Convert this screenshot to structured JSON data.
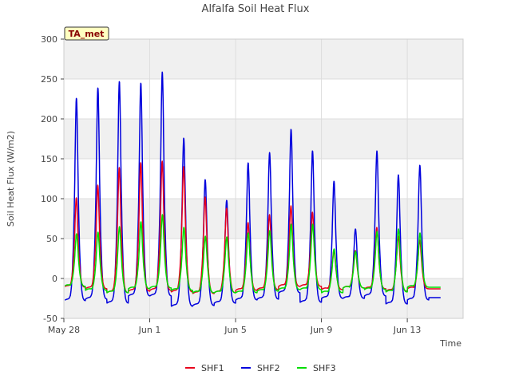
{
  "chart_data": {
    "type": "line",
    "title": "Alfalfa Soil Heat Flux",
    "xlabel": "Time",
    "ylabel": "Soil Heat Flux (W/m2)",
    "badge": "TA_met",
    "ylim": [
      -50,
      300
    ],
    "yticks": [
      -50,
      0,
      50,
      100,
      150,
      200,
      250,
      300
    ],
    "xlim_days": [
      0,
      18.6
    ],
    "xticks": [
      {
        "day": 0,
        "label": "May 28"
      },
      {
        "day": 4,
        "label": "Jun 1"
      },
      {
        "day": 8,
        "label": "Jun 5"
      },
      {
        "day": 12,
        "label": "Jun 9"
      },
      {
        "day": 16,
        "label": "Jun 13"
      }
    ],
    "legend_position": "bottom",
    "grid": true,
    "daily_peaks": {
      "days": [
        0,
        1,
        2,
        3,
        4,
        5,
        6,
        7,
        8,
        9,
        10,
        11,
        12,
        13,
        14,
        15,
        16,
        17
      ],
      "series": [
        {
          "name": "SHF1",
          "color": "#e8001c",
          "peak": [
            101,
            117,
            139,
            145,
            147,
            140,
            102,
            88,
            70,
            80,
            91,
            83,
            35,
            35,
            64,
            53,
            48,
            -1
          ],
          "min": [
            -11,
            -13,
            -18,
            -16,
            -15,
            -17,
            -19,
            -18,
            -15,
            -14,
            -10,
            -10,
            -14,
            -12,
            -13,
            -16,
            -13,
            -13
          ]
        },
        {
          "name": "SHF2",
          "color": "#0000dd",
          "peak": [
            226,
            239,
            247,
            245,
            259,
            176,
            124,
            98,
            145,
            158,
            187,
            160,
            122,
            62,
            160,
            130,
            142,
            -1
          ],
          "min": [
            -28,
            -26,
            -31,
            -22,
            -22,
            -35,
            -34,
            -31,
            -27,
            -26,
            -18,
            -30,
            -25,
            -25,
            -22,
            -32,
            -27,
            -24
          ]
        },
        {
          "name": "SHF3",
          "color": "#00dd00",
          "peak": [
            56,
            58,
            65,
            71,
            80,
            64,
            53,
            52,
            57,
            60,
            68,
            68,
            37,
            34,
            59,
            62,
            57,
            -1
          ],
          "min": [
            -10,
            -15,
            -18,
            -13,
            -12,
            -15,
            -18,
            -18,
            -18,
            -16,
            -14,
            -14,
            -18,
            -12,
            -14,
            -17,
            -11,
            -11
          ]
        }
      ]
    }
  }
}
